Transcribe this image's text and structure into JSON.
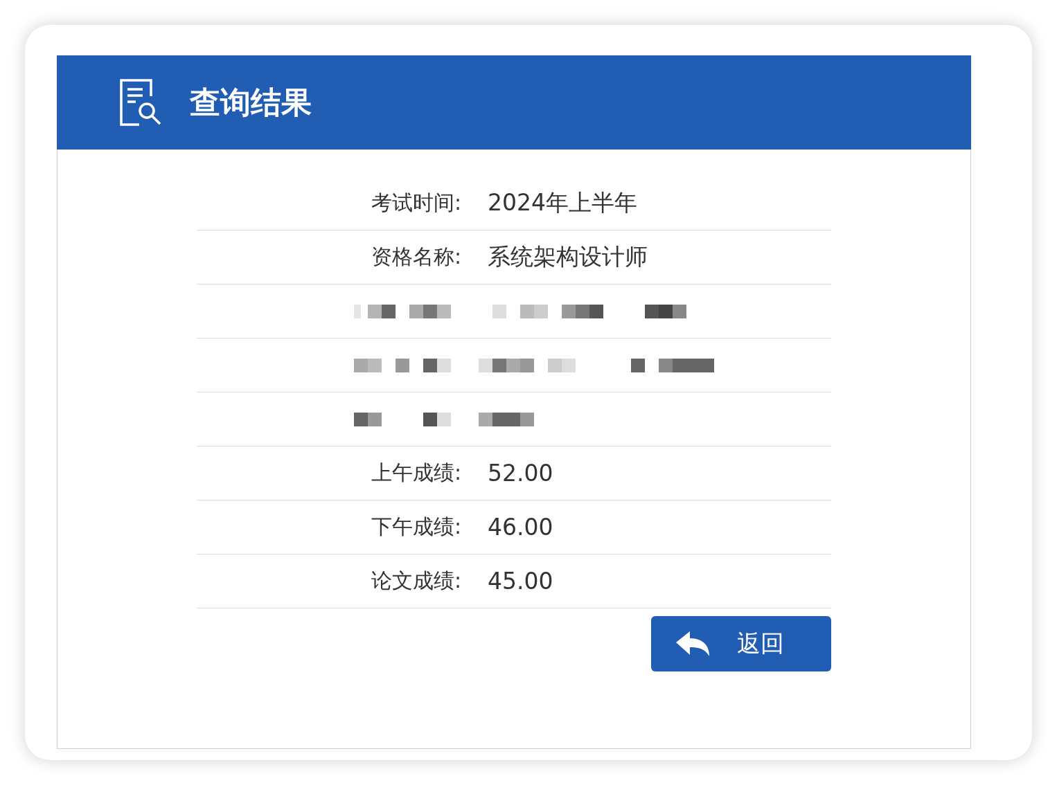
{
  "header": {
    "title": "查询结果"
  },
  "rows": [
    {
      "kind": "field",
      "label": "考试时间:",
      "value": "2024年上半年"
    },
    {
      "kind": "field",
      "label": "资格名称:",
      "value": "系统架构设计师"
    },
    {
      "kind": "redacted"
    },
    {
      "kind": "redacted"
    },
    {
      "kind": "redacted"
    },
    {
      "kind": "field",
      "label": "上午成绩:",
      "value": "52.00"
    },
    {
      "kind": "field",
      "label": "下午成绩:",
      "value": "46.00"
    },
    {
      "kind": "field",
      "label": "论文成绩:",
      "value": "45.00"
    }
  ],
  "buttons": [
    {
      "label": "返回"
    }
  ]
}
